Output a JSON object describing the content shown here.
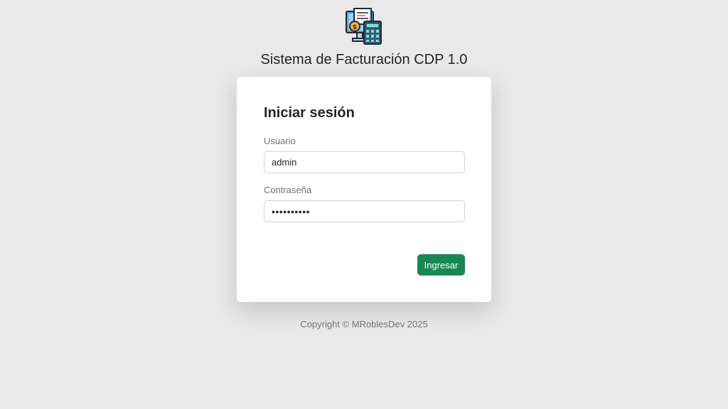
{
  "header": {
    "logo_icon": "invoice-calculator-icon",
    "title": "Sistema de Facturación CDP 1.0"
  },
  "login": {
    "heading": "Iniciar sesión",
    "username_label": "Usuario",
    "username_value": "admin",
    "password_label": "Contraseña",
    "password_value": "••••••••••",
    "submit_label": "Ingresar"
  },
  "footer": {
    "copyright": "Copyright © MRoblesDev 2025"
  },
  "colors": {
    "background": "#e9e9e9",
    "card": "#ffffff",
    "primary_button": "#198754",
    "muted_text": "#6c757d"
  }
}
